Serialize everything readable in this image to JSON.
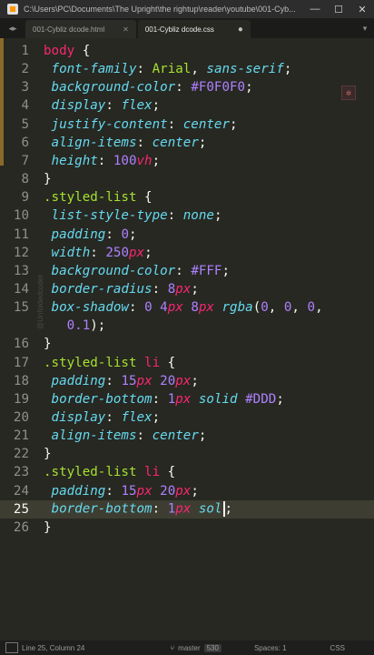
{
  "window": {
    "title": "C:\\Users\\PC\\Documents\\The Upright\\the rightup\\reader\\youtube\\001-Cyb...",
    "min": "—",
    "max": "☐",
    "close": "✕"
  },
  "tabs": [
    {
      "label": "001-Cybliz dcode.html",
      "active": false,
      "marker": "✕"
    },
    {
      "label": "001-Cybliz dcode.css",
      "active": true,
      "marker": "●"
    }
  ],
  "tabnav": {
    "left": "◂",
    "right": "▸",
    "overflow": "▾"
  },
  "watermark": "@Unfoldedcoder",
  "code_lines": [
    {
      "n": "1",
      "tokens": [
        [
          "sel",
          "body"
        ],
        [
          "punc",
          " {"
        ]
      ]
    },
    {
      "n": "2",
      "tokens": [
        [
          "punc",
          " "
        ],
        [
          "prop",
          "font-family"
        ],
        [
          "punc",
          ": "
        ],
        [
          "str",
          "Arial"
        ],
        [
          "punc",
          ", "
        ],
        [
          "val",
          "sans-serif"
        ],
        [
          "punc",
          ";"
        ]
      ]
    },
    {
      "n": "3",
      "tokens": [
        [
          "punc",
          " "
        ],
        [
          "prop",
          "background-color"
        ],
        [
          "punc",
          ": "
        ],
        [
          "hex",
          "#F0F0F0"
        ],
        [
          "punc",
          ";"
        ]
      ]
    },
    {
      "n": "4",
      "tokens": [
        [
          "punc",
          " "
        ],
        [
          "prop",
          "display"
        ],
        [
          "punc",
          ": "
        ],
        [
          "val",
          "flex"
        ],
        [
          "punc",
          ";"
        ]
      ]
    },
    {
      "n": "5",
      "tokens": [
        [
          "punc",
          " "
        ],
        [
          "prop",
          "justify-content"
        ],
        [
          "punc",
          ": "
        ],
        [
          "val",
          "center"
        ],
        [
          "punc",
          ";"
        ]
      ]
    },
    {
      "n": "6",
      "tokens": [
        [
          "punc",
          " "
        ],
        [
          "prop",
          "align-items"
        ],
        [
          "punc",
          ": "
        ],
        [
          "val",
          "center"
        ],
        [
          "punc",
          ";"
        ]
      ]
    },
    {
      "n": "7",
      "tokens": [
        [
          "punc",
          " "
        ],
        [
          "prop",
          "height"
        ],
        [
          "punc",
          ": "
        ],
        [
          "num",
          "100"
        ],
        [
          "unit",
          "vh"
        ],
        [
          "punc",
          ";"
        ]
      ]
    },
    {
      "n": "8",
      "tokens": [
        [
          "punc",
          "}"
        ]
      ]
    },
    {
      "n": "9",
      "tokens": [
        [
          "str",
          ".styled-list"
        ],
        [
          "punc",
          " {"
        ]
      ]
    },
    {
      "n": "10",
      "tokens": [
        [
          "punc",
          " "
        ],
        [
          "prop",
          "list-style-type"
        ],
        [
          "punc",
          ": "
        ],
        [
          "val",
          "none"
        ],
        [
          "punc",
          ";"
        ]
      ]
    },
    {
      "n": "11",
      "tokens": [
        [
          "punc",
          " "
        ],
        [
          "prop",
          "padding"
        ],
        [
          "punc",
          ": "
        ],
        [
          "num",
          "0"
        ],
        [
          "punc",
          ";"
        ]
      ]
    },
    {
      "n": "12",
      "tokens": [
        [
          "punc",
          " "
        ],
        [
          "prop",
          "width"
        ],
        [
          "punc",
          ": "
        ],
        [
          "num",
          "250"
        ],
        [
          "unit",
          "px"
        ],
        [
          "punc",
          ";"
        ]
      ]
    },
    {
      "n": "13",
      "tokens": [
        [
          "punc",
          " "
        ],
        [
          "prop",
          "background-color"
        ],
        [
          "punc",
          ": "
        ],
        [
          "hex",
          "#FFF"
        ],
        [
          "punc",
          ";"
        ]
      ]
    },
    {
      "n": "14",
      "tokens": [
        [
          "punc",
          " "
        ],
        [
          "prop",
          "border-radius"
        ],
        [
          "punc",
          ": "
        ],
        [
          "num",
          "8"
        ],
        [
          "unit",
          "px"
        ],
        [
          "punc",
          ";"
        ]
      ]
    },
    {
      "n": "15",
      "tokens": [
        [
          "punc",
          " "
        ],
        [
          "prop",
          "box-shadow"
        ],
        [
          "punc",
          ": "
        ],
        [
          "num",
          "0 4"
        ],
        [
          "unit",
          "px"
        ],
        [
          "punc",
          " "
        ],
        [
          "num",
          "8"
        ],
        [
          "unit",
          "px"
        ],
        [
          "punc",
          " "
        ],
        [
          "fn",
          "rgba"
        ],
        [
          "punc",
          "("
        ],
        [
          "num",
          "0"
        ],
        [
          "punc",
          ", "
        ],
        [
          "num",
          "0"
        ],
        [
          "punc",
          ", "
        ],
        [
          "num",
          "0"
        ],
        [
          "punc",
          ","
        ]
      ]
    },
    {
      "n": "",
      "tokens": [
        [
          "punc",
          "   "
        ],
        [
          "num",
          "0.1"
        ],
        [
          "punc",
          ");"
        ]
      ]
    },
    {
      "n": "16",
      "tokens": [
        [
          "punc",
          "}"
        ]
      ]
    },
    {
      "n": "17",
      "tokens": [
        [
          "str",
          ".styled-list"
        ],
        [
          "punc",
          " "
        ],
        [
          "sel",
          "li"
        ],
        [
          "punc",
          " {"
        ]
      ]
    },
    {
      "n": "18",
      "tokens": [
        [
          "punc",
          " "
        ],
        [
          "prop",
          "padding"
        ],
        [
          "punc",
          ": "
        ],
        [
          "num",
          "15"
        ],
        [
          "unit",
          "px"
        ],
        [
          "punc",
          " "
        ],
        [
          "num",
          "20"
        ],
        [
          "unit",
          "px"
        ],
        [
          "punc",
          ";"
        ]
      ]
    },
    {
      "n": "19",
      "tokens": [
        [
          "punc",
          " "
        ],
        [
          "prop",
          "border-bottom"
        ],
        [
          "punc",
          ": "
        ],
        [
          "num",
          "1"
        ],
        [
          "unit",
          "px"
        ],
        [
          "punc",
          " "
        ],
        [
          "val",
          "solid"
        ],
        [
          "punc",
          " "
        ],
        [
          "hex",
          "#DDD"
        ],
        [
          "punc",
          ";"
        ]
      ]
    },
    {
      "n": "20",
      "tokens": [
        [
          "punc",
          " "
        ],
        [
          "prop",
          "display"
        ],
        [
          "punc",
          ": "
        ],
        [
          "val",
          "flex"
        ],
        [
          "punc",
          ";"
        ]
      ]
    },
    {
      "n": "21",
      "tokens": [
        [
          "punc",
          " "
        ],
        [
          "prop",
          "align-items"
        ],
        [
          "punc",
          ": "
        ],
        [
          "val",
          "center"
        ],
        [
          "punc",
          ";"
        ]
      ]
    },
    {
      "n": "22",
      "tokens": [
        [
          "punc",
          "}"
        ]
      ]
    },
    {
      "n": "23",
      "tokens": [
        [
          "str",
          ".styled-list"
        ],
        [
          "punc",
          " "
        ],
        [
          "sel",
          "li"
        ],
        [
          "punc",
          " {"
        ]
      ]
    },
    {
      "n": "24",
      "tokens": [
        [
          "punc",
          " "
        ],
        [
          "prop",
          "padding"
        ],
        [
          "punc",
          ": "
        ],
        [
          "num",
          "15"
        ],
        [
          "unit",
          "px"
        ],
        [
          "punc",
          " "
        ],
        [
          "num",
          "20"
        ],
        [
          "unit",
          "px"
        ],
        [
          "punc",
          ";"
        ]
      ]
    },
    {
      "n": "25",
      "current": true,
      "cursor": true,
      "tokens": [
        [
          "punc",
          " "
        ],
        [
          "prop",
          "border-bottom"
        ],
        [
          "punc",
          ": "
        ],
        [
          "num",
          "1"
        ],
        [
          "unit",
          "px"
        ],
        [
          "punc",
          " "
        ],
        [
          "val",
          "sol"
        ],
        [
          "punc",
          ";"
        ]
      ]
    },
    {
      "n": "26",
      "tokens": [
        [
          "punc",
          "}"
        ]
      ]
    }
  ],
  "status": {
    "position": "Line 25, Column 24",
    "branch": "master",
    "badge": "530",
    "spaces": "Spaces: 1",
    "syntax": "CSS"
  }
}
